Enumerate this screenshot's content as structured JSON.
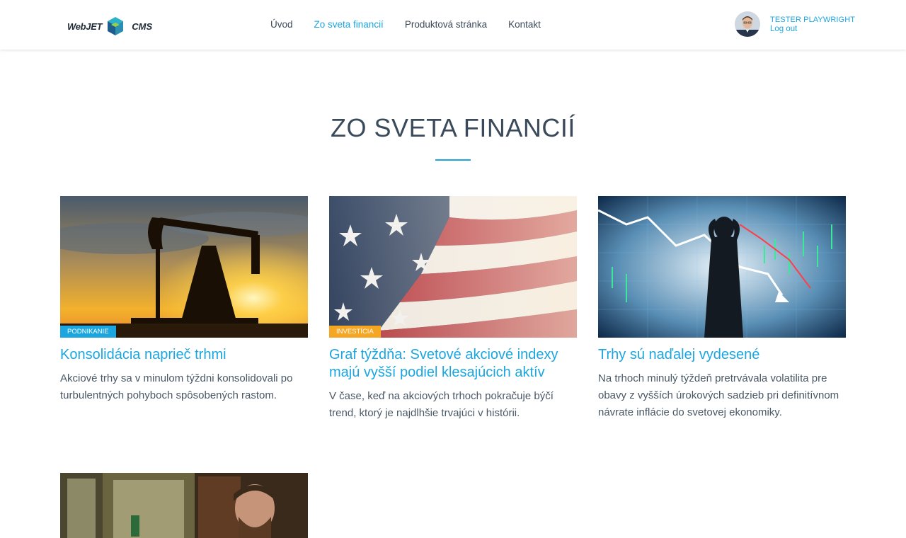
{
  "header": {
    "logo": {
      "left_text": "WebJET",
      "right_text": "CMS"
    },
    "nav": [
      {
        "label": "Úvod",
        "active": false
      },
      {
        "label": "Zo sveta financií",
        "active": true
      },
      {
        "label": "Produktová stránka",
        "active": false
      },
      {
        "label": "Kontakt",
        "active": false
      }
    ],
    "user": {
      "name": "TESTER PLAYWRIGHT",
      "logout_label": "Log out"
    }
  },
  "main": {
    "title": "ZO SVETA FINANCIÍ",
    "articles": [
      {
        "category": "PODNIKANIE",
        "category_color": "#1ba6e0",
        "title": "Konsolidácia naprieč trhmi",
        "perex": "Akciové trhy sa v minulom týždni konsolidovali po turbulentných pohyboch spôsobených rastom."
      },
      {
        "category": "INVESTÍCIA",
        "category_color": "#f5a623",
        "title": "Graf týždňa: Svetové akciové indexy majú vyšší podiel klesajúcich aktív",
        "perex": "V čase, keď na akciových trhoch pokračuje býčí trend, ktorý je najdlhšie trvajúci v histórii."
      },
      {
        "category": "",
        "title": "Trhy sú naďalej vydesené",
        "perex": "Na trhoch minulý týždeň pretrvávala volatilita pre obavy z vyšších úrokových sadzieb pri definitívnom návrate inflácie do svetovej ekonomiky."
      }
    ]
  },
  "colors": {
    "accent": "#1ba6e0",
    "badge_orange": "#f5a623",
    "text": "#3b4a5a"
  }
}
